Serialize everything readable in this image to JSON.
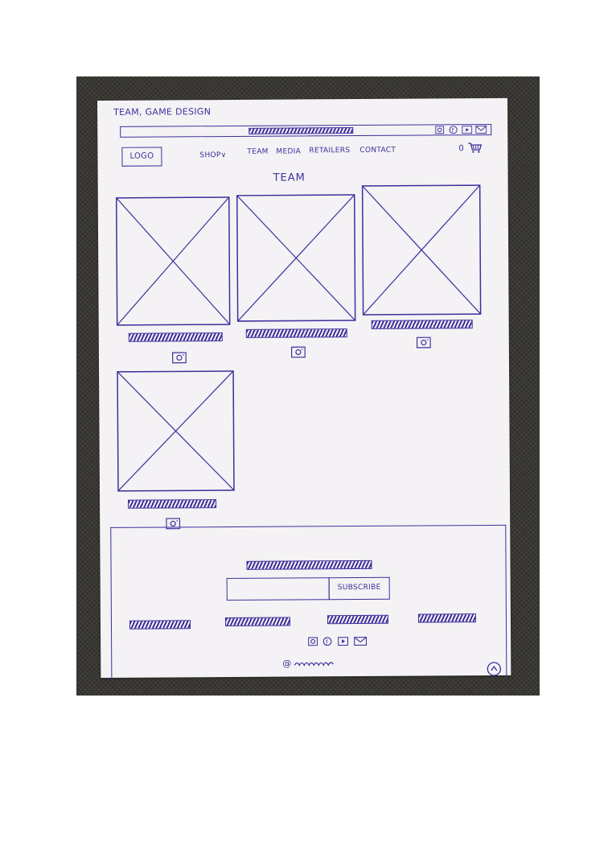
{
  "sketch": {
    "title": "TEAM, GAME DESIGN",
    "logo": "LOGO",
    "nav": [
      "SHOP∨",
      "TEAM",
      "MEDIA",
      "RETAILERS",
      "CONTACT"
    ],
    "cart_count": "0",
    "section_heading": "TEAM",
    "subscribe_label": "SUBSCRIBE",
    "copyright": "@",
    "ink_color": "#3d2f9c",
    "paper_color": "#f4f2f4",
    "top_bar_icons": [
      "instagram-icon",
      "facebook-icon",
      "youtube-icon",
      "mail-icon"
    ],
    "footer_icons": [
      "instagram-icon",
      "facebook-icon",
      "youtube-icon",
      "mail-icon"
    ],
    "team_members": [
      {
        "photo": "image-placeholder",
        "social": "instagram-icon"
      },
      {
        "photo": "image-placeholder",
        "social": "instagram-icon"
      },
      {
        "photo": "image-placeholder",
        "social": "instagram-icon"
      },
      {
        "photo": "image-placeholder",
        "social": "instagram-icon"
      }
    ]
  }
}
